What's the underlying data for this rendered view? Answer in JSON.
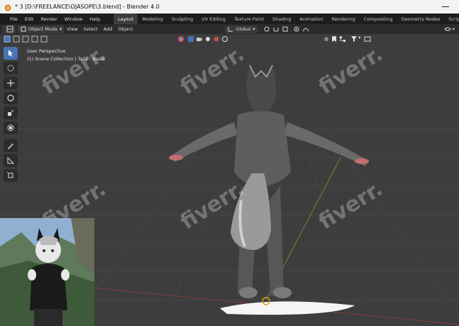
{
  "window": {
    "title": "* 3 [D:\\FREELANCE\\OJASOPE\\3.blend] - Blender 4.0"
  },
  "menu": {
    "items": [
      "File",
      "Edit",
      "Render",
      "Window",
      "Help"
    ]
  },
  "workspace_tabs": [
    {
      "label": "Layout",
      "active": true
    },
    {
      "label": "Modeling",
      "active": false
    },
    {
      "label": "Sculpting",
      "active": false
    },
    {
      "label": "UV Editing",
      "active": false
    },
    {
      "label": "Texture Paint",
      "active": false
    },
    {
      "label": "Shading",
      "active": false
    },
    {
      "label": "Animation",
      "active": false
    },
    {
      "label": "Rendering",
      "active": false
    },
    {
      "label": "Compositing",
      "active": false
    },
    {
      "label": "Geometry Nodes",
      "active": false
    },
    {
      "label": "Scripting",
      "active": false
    }
  ],
  "header": {
    "mode": "Object Mode",
    "menus": [
      "View",
      "Select",
      "Add",
      "Object"
    ],
    "orientation": "Global"
  },
  "viewport": {
    "perspective_label": "User Perspective",
    "collection_label": "(1) Scene Collection | Tail1 : Basis"
  },
  "watermark_text": "fiverr.",
  "colors": {
    "accent": "#4772b3",
    "viewport_bg": "#3d3d3d",
    "menubar_bg": "#1d1d1d"
  }
}
